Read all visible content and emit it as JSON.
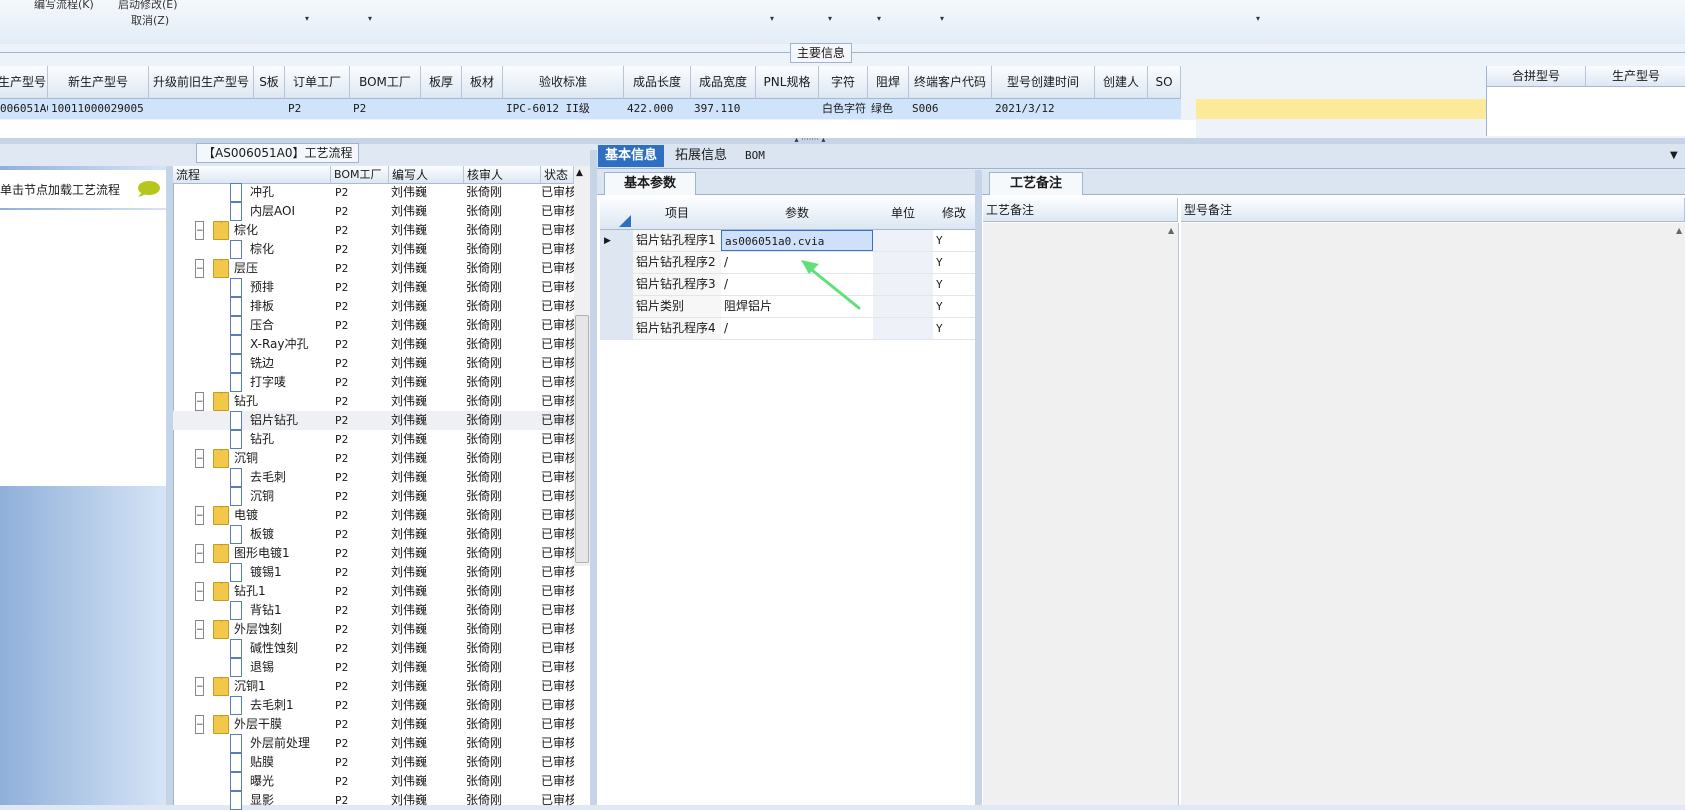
{
  "toolbar": {
    "menu_edit_flow": "编写流程(K)",
    "menu_start_modify": "启动修改(E)",
    "menu_cancel": "取消(Z)",
    "dropdown_arrow": "▾"
  },
  "main_info": {
    "section_title": "主要信息",
    "columns": [
      "生产型号",
      "新生产型号",
      "升级前旧生产型号",
      "S板",
      "订单工厂",
      "BOM工厂",
      "板厚",
      "板材",
      "验收标准",
      "成品长度",
      "成品宽度",
      "PNL规格",
      "字符",
      "阻焊",
      "终端客户代码",
      "型号创建时间",
      "创建人",
      "SO"
    ],
    "row": [
      "006051A0",
      "10011000029005",
      "",
      "",
      "P2",
      "P2",
      "",
      "",
      "IPC-6012 II级",
      "422.000",
      "397.110",
      "",
      "白色字符",
      "绿色",
      "S006",
      "2021/3/12",
      "",
      ""
    ],
    "right_columns": [
      "合拼型号",
      "生产型号"
    ]
  },
  "left_panel": {
    "hint": "单击节点加载工艺流程"
  },
  "tree": {
    "title": "【AS006051A0】工艺流程",
    "columns": [
      "流程",
      "BOM工厂",
      "编写人",
      "核审人",
      "状态"
    ],
    "rows": [
      {
        "name": "冲孔",
        "level": 2,
        "factory": "P2",
        "writer": "刘伟巍",
        "reviewer": "张倚刚",
        "status": "已审核"
      },
      {
        "name": "内层AOI",
        "level": 2,
        "factory": "P2",
        "writer": "刘伟巍",
        "reviewer": "张倚刚",
        "status": "已审核"
      },
      {
        "name": "棕化",
        "level": 1,
        "factory": "P2",
        "writer": "刘伟巍",
        "reviewer": "张倚刚",
        "status": "已审核"
      },
      {
        "name": "棕化",
        "level": 2,
        "factory": "P2",
        "writer": "刘伟巍",
        "reviewer": "张倚刚",
        "status": "已审核"
      },
      {
        "name": "层压",
        "level": 1,
        "factory": "P2",
        "writer": "刘伟巍",
        "reviewer": "张倚刚",
        "status": "已审核"
      },
      {
        "name": "预排",
        "level": 2,
        "factory": "P2",
        "writer": "刘伟巍",
        "reviewer": "张倚刚",
        "status": "已审核"
      },
      {
        "name": "排板",
        "level": 2,
        "factory": "P2",
        "writer": "刘伟巍",
        "reviewer": "张倚刚",
        "status": "已审核"
      },
      {
        "name": "压合",
        "level": 2,
        "factory": "P2",
        "writer": "刘伟巍",
        "reviewer": "张倚刚",
        "status": "已审核"
      },
      {
        "name": "X-Ray冲孔",
        "level": 2,
        "factory": "P2",
        "writer": "刘伟巍",
        "reviewer": "张倚刚",
        "status": "已审核"
      },
      {
        "name": "铣边",
        "level": 2,
        "factory": "P2",
        "writer": "刘伟巍",
        "reviewer": "张倚刚",
        "status": "已审核"
      },
      {
        "name": "打字唛",
        "level": 2,
        "factory": "P2",
        "writer": "刘伟巍",
        "reviewer": "张倚刚",
        "status": "已审核"
      },
      {
        "name": "钻孔",
        "level": 1,
        "factory": "P2",
        "writer": "刘伟巍",
        "reviewer": "张倚刚",
        "status": "已审核"
      },
      {
        "name": "铝片钻孔",
        "level": 2,
        "factory": "P2",
        "writer": "刘伟巍",
        "reviewer": "张倚刚",
        "status": "已审核",
        "selected": true
      },
      {
        "name": "钻孔",
        "level": 2,
        "factory": "P2",
        "writer": "刘伟巍",
        "reviewer": "张倚刚",
        "status": "已审核"
      },
      {
        "name": "沉铜",
        "level": 1,
        "factory": "P2",
        "writer": "刘伟巍",
        "reviewer": "张倚刚",
        "status": "已审核"
      },
      {
        "name": "去毛刺",
        "level": 2,
        "factory": "P2",
        "writer": "刘伟巍",
        "reviewer": "张倚刚",
        "status": "已审核"
      },
      {
        "name": "沉铜",
        "level": 2,
        "factory": "P2",
        "writer": "刘伟巍",
        "reviewer": "张倚刚",
        "status": "已审核"
      },
      {
        "name": "电镀",
        "level": 1,
        "factory": "P2",
        "writer": "刘伟巍",
        "reviewer": "张倚刚",
        "status": "已审核"
      },
      {
        "name": "板镀",
        "level": 2,
        "factory": "P2",
        "writer": "刘伟巍",
        "reviewer": "张倚刚",
        "status": "已审核"
      },
      {
        "name": "图形电镀1",
        "level": 1,
        "factory": "P2",
        "writer": "刘伟巍",
        "reviewer": "张倚刚",
        "status": "已审核"
      },
      {
        "name": "镀锡1",
        "level": 2,
        "factory": "P2",
        "writer": "刘伟巍",
        "reviewer": "张倚刚",
        "status": "已审核"
      },
      {
        "name": "钻孔1",
        "level": 1,
        "factory": "P2",
        "writer": "刘伟巍",
        "reviewer": "张倚刚",
        "status": "已审核"
      },
      {
        "name": "背钻1",
        "level": 2,
        "factory": "P2",
        "writer": "刘伟巍",
        "reviewer": "张倚刚",
        "status": "已审核"
      },
      {
        "name": "外层蚀刻",
        "level": 1,
        "factory": "P2",
        "writer": "刘伟巍",
        "reviewer": "张倚刚",
        "status": "已审核"
      },
      {
        "name": "碱性蚀刻",
        "level": 2,
        "factory": "P2",
        "writer": "刘伟巍",
        "reviewer": "张倚刚",
        "status": "已审核"
      },
      {
        "name": "退锡",
        "level": 2,
        "factory": "P2",
        "writer": "刘伟巍",
        "reviewer": "张倚刚",
        "status": "已审核"
      },
      {
        "name": "沉铜1",
        "level": 1,
        "factory": "P2",
        "writer": "刘伟巍",
        "reviewer": "张倚刚",
        "status": "已审核"
      },
      {
        "name": "去毛刺1",
        "level": 2,
        "factory": "P2",
        "writer": "刘伟巍",
        "reviewer": "张倚刚",
        "status": "已审核"
      },
      {
        "name": "外层干膜",
        "level": 1,
        "factory": "P2",
        "writer": "刘伟巍",
        "reviewer": "张倚刚",
        "status": "已审核"
      },
      {
        "name": "外层前处理",
        "level": 2,
        "factory": "P2",
        "writer": "刘伟巍",
        "reviewer": "张倚刚",
        "status": "已审核"
      },
      {
        "name": "贴膜",
        "level": 2,
        "factory": "P2",
        "writer": "刘伟巍",
        "reviewer": "张倚刚",
        "status": "已审核"
      },
      {
        "name": "曝光",
        "level": 2,
        "factory": "P2",
        "writer": "刘伟巍",
        "reviewer": "张倚刚",
        "status": "已审核"
      },
      {
        "name": "显影",
        "level": 2,
        "factory": "P2",
        "writer": "刘伟巍",
        "reviewer": "张倚刚",
        "status": "已审核"
      }
    ]
  },
  "tabs": [
    "基本信息",
    "拓展信息",
    "BOM"
  ],
  "params": {
    "tab_label": "基本参数",
    "columns": [
      "项目",
      "参数",
      "单位",
      "修改"
    ],
    "rows": [
      {
        "item": "铝片钻孔程序1",
        "value": "as006051a0.cvia",
        "unit": "",
        "mod": "Y",
        "editing": true
      },
      {
        "item": "铝片钻孔程序2",
        "value": "/",
        "unit": "",
        "mod": "Y"
      },
      {
        "item": "铝片钻孔程序3",
        "value": "/",
        "unit": "",
        "mod": "Y"
      },
      {
        "item": "铝片类别",
        "value": "阻焊铝片",
        "unit": "",
        "mod": "Y"
      },
      {
        "item": "铝片钻孔程序4",
        "value": "/",
        "unit": "",
        "mod": "Y"
      }
    ]
  },
  "remarks": {
    "tab_label": "工艺备注",
    "col_process": "工艺备注",
    "col_model": "型号备注"
  },
  "colors": {
    "accent": "#2f6fc1",
    "selected_row": "#cfe3fb",
    "highlight_yellow": "#fde99a",
    "annotation_arrow": "#5fe07a"
  }
}
